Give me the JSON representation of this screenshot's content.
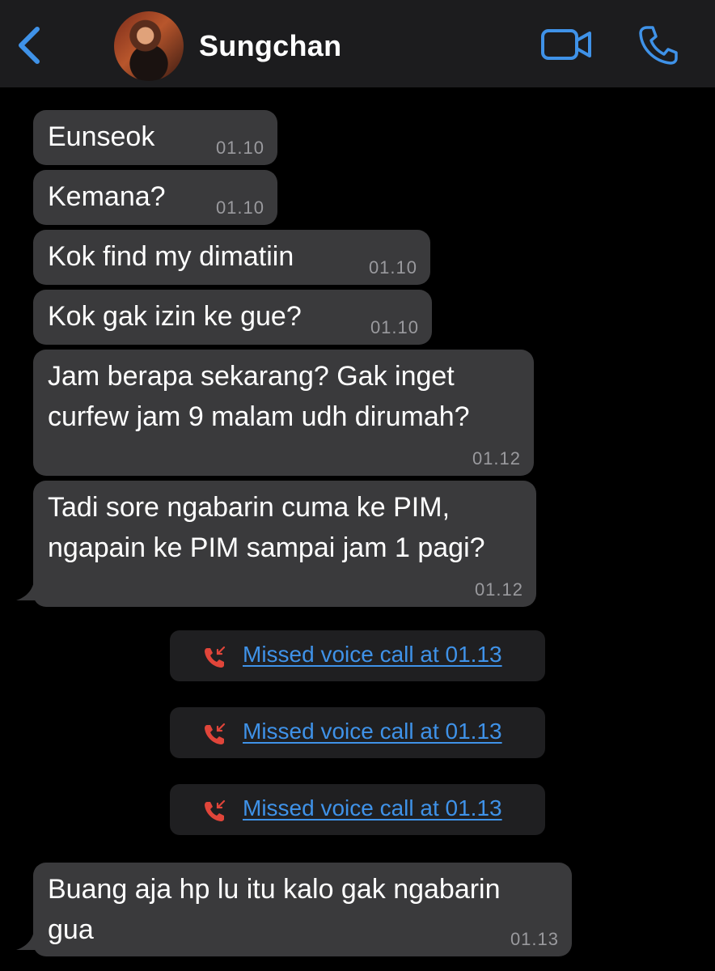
{
  "header": {
    "contact_name": "Sungchan",
    "back_icon": "chevron-left-icon",
    "video_icon": "video-camera-icon",
    "call_icon": "phone-icon",
    "accent_color": "#3f92e8"
  },
  "messages": [
    {
      "text": "Eunseok",
      "time": "01.10"
    },
    {
      "text": "Kemana?",
      "time": "01.10"
    },
    {
      "text": "Kok find my dimatiin",
      "time": "01.10"
    },
    {
      "text": "Kok gak izin ke gue?",
      "time": "01.10"
    },
    {
      "text": "Jam berapa sekarang? Gak inget\ncurfew jam 9 malam udh dirumah?",
      "time": "01.12"
    },
    {
      "text": "Tadi sore ngabarin cuma ke PIM,\nngapain ke PIM sampai jam 1 pagi?",
      "time": "01.12"
    }
  ],
  "missed_calls": [
    {
      "text": "Missed voice call at 01.13",
      "icon": "missed-call-icon"
    },
    {
      "text": "Missed voice call at 01.13",
      "icon": "missed-call-icon"
    },
    {
      "text": "Missed voice call at 01.13",
      "icon": "missed-call-icon"
    }
  ],
  "last_message": {
    "text": "Buang aja hp lu itu kalo gak ngabarin\ngua",
    "time": "01.13"
  },
  "colors": {
    "background": "#000000",
    "header_bg": "#1c1c1e",
    "bubble_bg": "#3a3a3c",
    "missed_call_red": "#e0453a",
    "link_blue": "#3f92e8"
  }
}
